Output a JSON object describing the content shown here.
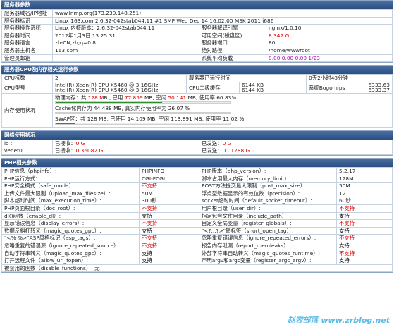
{
  "server_params": {
    "title": "服务器参数",
    "rows": [
      [
        "服务器域名/IP地址",
        "www.lnmp.org(173.230.148.251)"
      ],
      [
        "服务器标识",
        "Linux 163.com 2.6.32-042stab044.11 #1 SMP Wed Dec 14 16:02:00 MSK 2011 i686"
      ],
      [
        "服务器操作系统",
        "Linux  内核版本：2.6.32-042stab044.11",
        "服务器解译引擎",
        "nginx/1.0.10"
      ],
      [
        "服务器时间",
        "2012年1月3日 13:25:31",
        "可用空间(磁盘区)",
        "8.347 G"
      ],
      [
        "服务器语言",
        "zh-CN,zh;q=0.8",
        "服务器端口",
        "80"
      ],
      [
        "服务器主机名",
        "163.com",
        "绝对路径",
        "/home/wwwroot"
      ],
      [
        "管理员邮箱",
        "",
        "系统平均负载",
        "0.00 0.00 0.00 1/23"
      ]
    ]
  },
  "cpu_section": {
    "title": "服务器CPU及内存相关运行参数",
    "cpu_count_label": "CPU核数",
    "cpu_count": "2",
    "uptime_label": "服务器已运行时间",
    "uptime": "0天2小时48分钟",
    "cpu_model_label": "CPU型号",
    "cpu_model_1": "Intel(R) Xeon(R) CPU X5460 @ 3.16GHz",
    "cpu_model_2": "Intel(R) Xeon(R) CPU X5460 @ 3.16GHz",
    "cache_label": "CPU二级缓存",
    "cache_1": "6144 KB",
    "cache_2": "6144 KB",
    "bogomips_label": "系统Bogomips",
    "bogomips_1": "6333.63",
    "bogomips_2": "6333.37",
    "mem_label": "内存使用状况",
    "physical": {
      "p1": "物理内存：共 ",
      "total": "128 M",
      "p2": "B , 已用 ",
      "used": "77.859",
      "p3": " MB, 空闲 ",
      "free": "50.141",
      "p4": " MB, 使用率 ",
      "rate": "60.83%",
      "percent": 60.83
    },
    "cache_line": {
      "text": "Cache化内存为 44.488 MB, 真实内存使用率为 26.07 %",
      "percent": 26.07
    },
    "swap": {
      "p1": "SWAP区：共 128 MB, 已使用 14.109 MB, 空闲 113.891 MB, 使用率 ",
      "rate": "11.02 %",
      "percent": 11.02
    }
  },
  "network": {
    "title": "网络使用状况",
    "rows": [
      {
        "iface": "lo :",
        "rx_label": "已接收：",
        "rx": "0 G",
        "tx_label": "已发送：",
        "tx": "0 G"
      },
      {
        "iface": "venet0 :",
        "rx_label": "已接收：",
        "rx": "0.36082 G",
        "tx_label": "已发送：",
        "tx": "0.01288 G"
      }
    ]
  },
  "php": {
    "title": "PHP相关参数",
    "rows": [
      [
        "PHP信息（phpinfo）:",
        "PHPINFO",
        "PHP版本（php_version）:",
        "5.2.17"
      ],
      [
        "PHP运行方式：",
        "CGI-FCGI",
        "脚本占用最大内存（memory_limit）:",
        "128M"
      ],
      [
        "PHP安全模式（safe_mode）:",
        "不支持",
        "POST方法提交最大限制（post_max_size）:",
        "50M"
      ],
      [
        "上传文件最大限制（upload_max_filesize）:",
        "50M",
        "浮点型数据显示的有效位数（precision）:",
        "12"
      ],
      [
        "脚本超时时间（max_execution_time）:",
        "300秒",
        "socket超时时间（default_socket_timeout）:",
        "60秒"
      ],
      [
        "PHP页面根目录（doc_root）:",
        "不支持",
        "用户根目录（user_dir）:",
        "不支持"
      ],
      [
        "dl()函数（enable_dl）:",
        "支持",
        "指定包含文件目录（include_path）:",
        "支持"
      ],
      [
        "显示错误信息（display_errors）:",
        "不支持",
        "自定义全局变量（register_globals）:",
        "不支持"
      ],
      [
        "数据反斜杠转义（magic_quotes_gpc）:",
        "支持",
        "\"<?...?>\"短标签（short_open_tag）:",
        "支持"
      ],
      [
        "\"<% %>\"ASP风格标记（asp_tags）:",
        "不支持",
        "忽略重复错误信息（ignore_repeated_errors）:",
        "不支持"
      ],
      [
        "忽略重复的错误源（ignore_repeated_source）:",
        "不支持",
        "报告内存泄漏（report_memleaks）:",
        "支持"
      ],
      [
        "自动字符串转义（magic_quotes_gpc）:",
        "支持",
        "外部字符串自动转义（magic_quotes_runtime）:",
        "不支持"
      ],
      [
        "打开远程文件（allow_url_fopen）:",
        "支持",
        "声明argv和argc变量（register_argc_argv）:",
        "支持"
      ]
    ],
    "disabled_label": "被禁用的函数（disable_functions）:",
    "disabled_value": "无"
  },
  "watermark": "赵容部落 www.zrblog.net",
  "colors": {
    "header": "#35598b",
    "red": "#e00000",
    "green": "#1a9a1a",
    "bar": "#2f8d2f"
  }
}
